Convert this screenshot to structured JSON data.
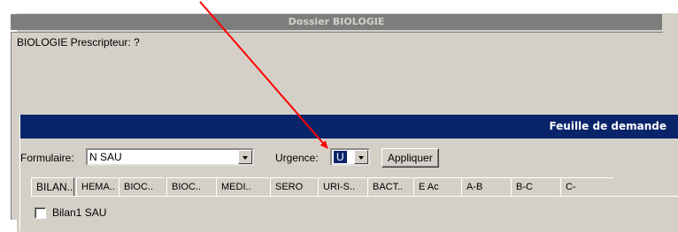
{
  "outer_window": {
    "title": "Dossier BIOLOGIE",
    "prescripteur_text": "BIOLOGIE Prescripteur: ?"
  },
  "inner_window": {
    "title": "Feuille de demande",
    "formulaire_label": "Formulaire:",
    "formulaire_value": "N SAU",
    "urgence_label": "Urgence:",
    "urgence_value": "U",
    "apply_label": "Appliquer",
    "tabs": [
      "BILAN..",
      "HEMA..",
      "BIOC..",
      "BIOC..",
      "MEDI..",
      "SERO",
      "URI-S..",
      "BACT..",
      "E Ac",
      "A-B",
      "B-C",
      "C-"
    ],
    "checkbox_label": "Bilan1 SAU"
  },
  "colors": {
    "title_active": "#0a246a",
    "title_inactive": "#7d7d7d",
    "face": "#d4d0c8",
    "arrow": "#ff0000"
  }
}
